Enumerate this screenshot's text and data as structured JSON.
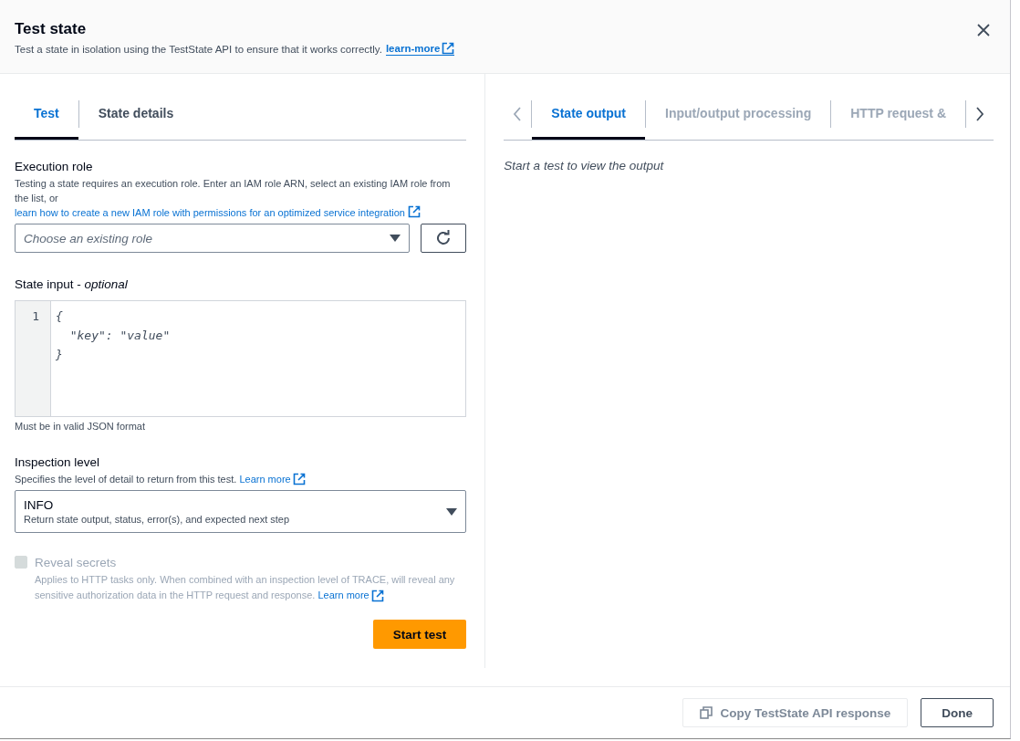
{
  "dialog": {
    "title": "Test state",
    "description": "Test a state in isolation using the TestState API to ensure that it works correctly.",
    "link": "learn-more"
  },
  "left_tabs": [
    {
      "label": "Test",
      "selected": true
    },
    {
      "label": "State details",
      "selected": false
    }
  ],
  "execution_role": {
    "label": "Execution role",
    "description": "Testing a state requires an execution role. Enter an IAM role ARN, select an existing IAM role from the list, or",
    "link": "learn how to create a new IAM role with permissions for an optimized service integration",
    "select": {
      "placeholder": "Choose an existing role"
    }
  },
  "state_input": {
    "label": "State input - *optional*",
    "line_numbers": [
      "1"
    ],
    "code_lines": [
      "{",
      "  \"key\": \"value\"",
      "}"
    ],
    "hint": "Must be in valid JSON format"
  },
  "inspection_level": {
    "label": "Inspection level",
    "description": "Specifies the level of detail to return from this test.",
    "link": "Learn more",
    "select": {
      "value": "INFO",
      "description": "Return state output, status, error(s), and expected next step"
    }
  },
  "reveal_secrets": {
    "label": "Reveal secrets",
    "checked": false,
    "disabled": true,
    "description": "Applies to HTTP tasks only. When combined with an inspection level of TRACE, will reveal any sensitive authorization data in the HTTP request and response.",
    "link": "Learn more"
  },
  "start_button": "Start test",
  "right_tabs": [
    {
      "label": "State output",
      "selected": true
    },
    {
      "label": "Input/output processing",
      "selected": false
    },
    {
      "label": "HTTP request &",
      "selected": false
    }
  ],
  "output_message": "Start a test to view the output",
  "footer_buttons": [
    {
      "label": "Copy TestState API response",
      "kind": "copy",
      "disabled": true
    },
    {
      "label": "Done",
      "kind": "plain",
      "disabled": false
    }
  ]
}
